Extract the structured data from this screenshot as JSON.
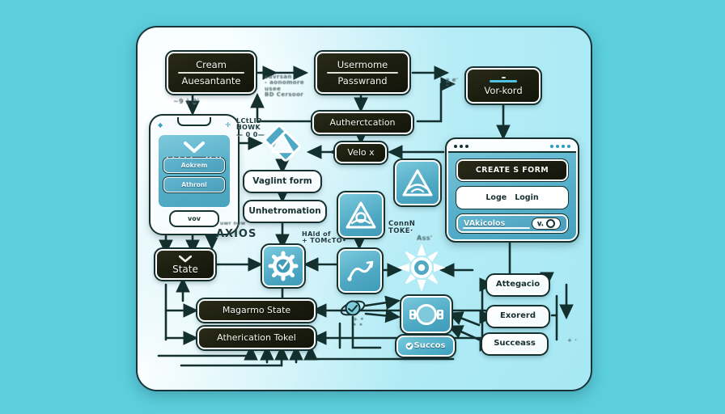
{
  "meta": {
    "background_color": "#5ccfdd",
    "canvas_color": "#d8f4fa",
    "ink_color": "#16322f",
    "accent_teal": "#4fa9c4",
    "dark_node_color": "#1d1f10"
  },
  "nodes": {
    "cream_auth": {
      "line1": "Cream",
      "line2": "Auesantante"
    },
    "username_password": {
      "line1": "Usermome",
      "line2": "Passwrand"
    },
    "vorkord": {
      "label": "Vor-kord"
    },
    "authentication": {
      "label": "Autherctcation"
    },
    "velo_x": {
      "label": "Velo x"
    },
    "vaglint_form": {
      "label": "Vaglint form"
    },
    "unhetromation": {
      "label": "Unhetromation"
    },
    "state": {
      "label": "State"
    },
    "magarme_state": {
      "label": "Magarmo State"
    },
    "atherication_token": {
      "label": "Atherication Tokel"
    },
    "succos": {
      "label": "Succos"
    },
    "attegacio": {
      "label": "Attegacio"
    },
    "exorerd": {
      "label": "Exorerd"
    },
    "succeass": {
      "label": "Succeass"
    }
  },
  "phone": {
    "field_1": "Aokrem",
    "field_2": "Athronl",
    "button": "vov",
    "dots_left": "• • • • •",
    "dots_right": "•• ••"
  },
  "browser": {
    "title": "CREATE S FORM",
    "row_left": "Loge",
    "row_right": "Login",
    "progress_label": "VAkicolos",
    "progress_pill": "v."
  },
  "annotations": {
    "top_scribble": "suvrsan\n- aonomore\nusee\nBD Cersoor",
    "login_hook": "LCtLID\nHOWK\n— 0 0—",
    "axios": "AXIOS",
    "axios_small": "uwr new",
    "half_of": "HAld of\n+ TOMcTO•",
    "conn_token": "ConnN\nTOKE·",
    "res_scribble": "Ass'",
    "left_arrow_mark": "~9 ) 0'",
    "right_mark_top": "x e'\n\" \"",
    "bottom_mark": "+ •\n• •"
  },
  "icons": {
    "diamond_nodes": "diamond-node-icon",
    "triangle_badge": "triangle-badge-icon",
    "gear_check": "gear-check-icon",
    "route": "route-icon",
    "sun_burst": "sunburst-icon",
    "lens": "lens-icon",
    "atom": "atom-icon",
    "chevron": "chevron-down-icon",
    "check_shield": "check-shield-icon"
  }
}
